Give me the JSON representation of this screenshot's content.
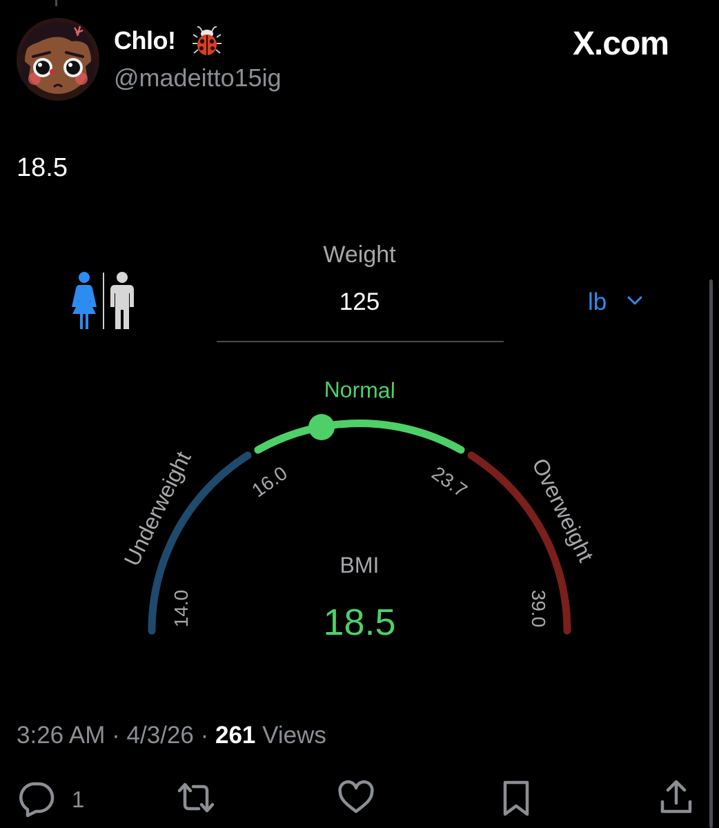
{
  "post": {
    "display_name": "Chlo!",
    "handle": "@madeitto15ig",
    "brand": "X.com",
    "text": "18.5",
    "time": "3:26 AM",
    "date": "4/3/26",
    "views_count": "261",
    "views_label": "Views",
    "sep": "·"
  },
  "icons": {
    "ladybug": "ladybug-emoji",
    "female": "female-figure",
    "male": "male-figure",
    "chevron": "chevron-down",
    "reply": "speech-bubble",
    "repost": "repost-arrows",
    "like": "heart",
    "bookmark": "bookmark",
    "share": "share-upload"
  },
  "bmi_app": {
    "weight_label": "Weight",
    "weight_value": "125",
    "unit": "lb",
    "gender_selected": "female",
    "bmi_label": "BMI",
    "bmi_value": "18.5",
    "scale": {
      "min": 14.0,
      "max": 39.0,
      "segments": [
        {
          "name": "Underweight",
          "from": 14.0,
          "to": 16.0,
          "color": "#1e4a6e"
        },
        {
          "name": "Normal",
          "from": 16.0,
          "to": 23.7,
          "color": "#4ed068"
        },
        {
          "name": "Overweight",
          "from": 23.7,
          "to": 39.0,
          "color": "#7a1f1c"
        }
      ],
      "ticks": [
        "14.0",
        "16.0",
        "23.7",
        "39.0"
      ]
    },
    "marker_value": 18.5
  },
  "actions": {
    "reply_count": "1"
  },
  "colors": {
    "background": "#000000",
    "accent_blue": "#2d8cf0",
    "bmi_green": "#4ed068",
    "muted_text": "#8b8f94"
  }
}
